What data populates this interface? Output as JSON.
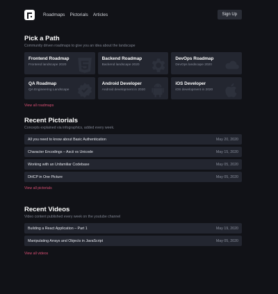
{
  "nav": {
    "links": [
      "Roadmaps",
      "Pictorials",
      "Articles"
    ],
    "signup": "Sign Up"
  },
  "roadmaps": {
    "title": "Pick a Path",
    "subtitle": "Community driven roadmaps to give you an idea about the landscape",
    "cards": [
      {
        "title": "Frontend Roadmap",
        "subtitle": "Frontend landscape 2020",
        "icon": "html5-icon"
      },
      {
        "title": "Backend Roadmap",
        "subtitle": "Backend landscape 2020",
        "icon": "gear-icon"
      },
      {
        "title": "DevOps Roadmap",
        "subtitle": "DevOps landscape 2020",
        "icon": "cloud-icon"
      },
      {
        "title": "QA Roadmap",
        "subtitle": "QA Engineering Landscape",
        "icon": "check-badge-icon"
      },
      {
        "title": "Android Developer",
        "subtitle": "Android development in 2020",
        "icon": "android-icon"
      },
      {
        "title": "iOS Developer",
        "subtitle": "iOS development in 2020",
        "icon": "apple-icon"
      }
    ],
    "more": "View all roadmaps"
  },
  "pictorials": {
    "title": "Recent Pictorials",
    "subtitle": "Concepts explained via infographics, added every week.",
    "items": [
      {
        "title": "All you need to know about Basic Authentication",
        "date": "May 20, 2020"
      },
      {
        "title": "Character Encodings – Ascii vs Unicode",
        "date": "May 15, 2020"
      },
      {
        "title": "Working with an Unfamiliar Codebase",
        "date": "May 05, 2020"
      },
      {
        "title": "DHCP in One Picture",
        "date": "May 05, 2020"
      }
    ],
    "more": "View all pictorials"
  },
  "videos": {
    "title": "Recent Videos",
    "subtitle": "Video content published every week on the youtube channel",
    "items": [
      {
        "title": "Building a React Application – Part 1",
        "date": "May 19, 2020"
      },
      {
        "title": "Manipulating Arrays and Objects in JavaScript",
        "date": "May 05, 2020"
      }
    ],
    "more": "View all videos"
  }
}
